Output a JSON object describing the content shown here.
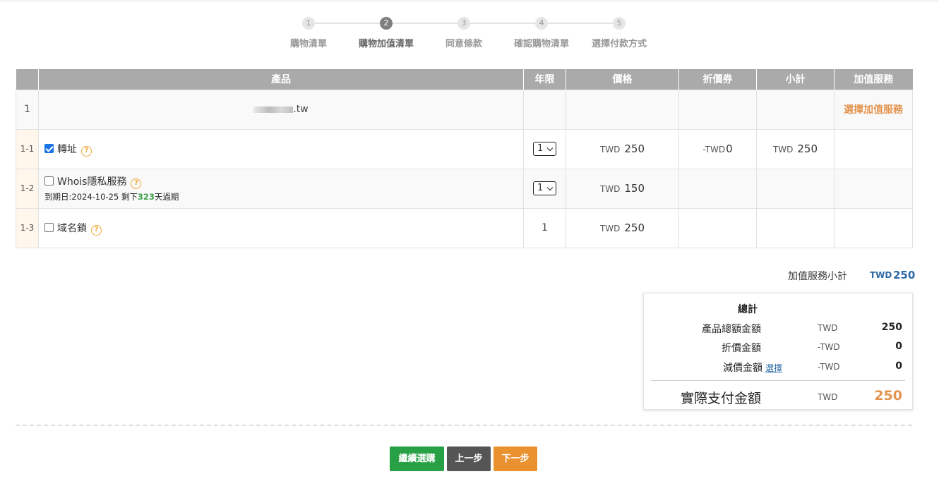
{
  "stepper": {
    "steps": [
      {
        "num": "1",
        "label": "購物清單"
      },
      {
        "num": "2",
        "label": "購物加值清單"
      },
      {
        "num": "3",
        "label": "同意條款"
      },
      {
        "num": "4",
        "label": "確認購物清單"
      },
      {
        "num": "5",
        "label": "選擇付款方式"
      }
    ],
    "active_step": 2
  },
  "table": {
    "headers": [
      "",
      "產品",
      "年限",
      "價格",
      "折價券",
      "小計",
      "加值服務"
    ],
    "main_row": {
      "index": "1",
      "domain_suffix": ".tw",
      "add_service_link": "選擇加值服務"
    },
    "rows": [
      {
        "index": "1-1",
        "name": "轉址",
        "checked": true,
        "years": "1",
        "price_currency": "TWD",
        "price": "250",
        "coupon_currency": "-TWD",
        "coupon": "0",
        "subtotal_currency": "TWD",
        "subtotal": "250"
      },
      {
        "index": "1-2",
        "name": "Whois隱私服務",
        "checked": false,
        "expiry_prefix": "到期日:2024-10-25 剩下",
        "expiry_days": "323",
        "expiry_suffix": "天過期",
        "years": "1",
        "price_currency": "TWD",
        "price": "150"
      },
      {
        "index": "1-3",
        "name": "域名鎖",
        "checked": false,
        "years": "1",
        "price_currency": "TWD",
        "price": "250"
      }
    ],
    "help_glyph": "?"
  },
  "addon_subtotal": {
    "label": "加值服務小計",
    "currency": "TWD",
    "value": "250"
  },
  "totals": {
    "title": "總計",
    "product_total": {
      "label": "產品總額金額",
      "currency": "TWD",
      "value": "250"
    },
    "discount": {
      "label": "折價金額",
      "currency": "-TWD",
      "value": "0"
    },
    "reduction": {
      "label": "減價金額",
      "link": "選擇",
      "currency": "-TWD",
      "value": "0"
    },
    "final": {
      "label": "實際支付金額",
      "currency": "TWD",
      "value": "250"
    }
  },
  "buttons": {
    "continue": "繼續選購",
    "prev": "上一步",
    "next": "下一步"
  },
  "colors": {
    "accent_orange": "#e3944e",
    "link_blue": "#2e6aa6",
    "green": "#27a046",
    "header_gray": "#aaaaaa"
  }
}
